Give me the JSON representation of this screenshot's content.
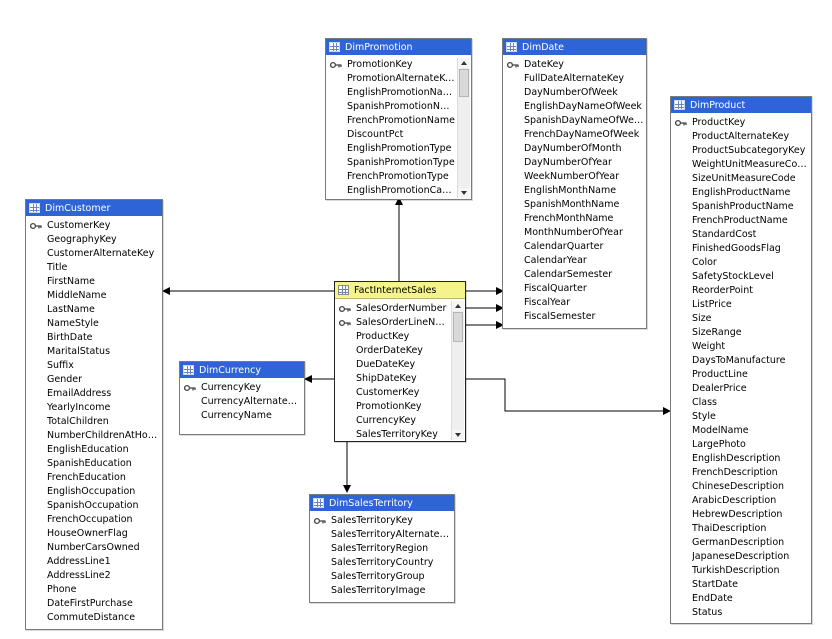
{
  "tables": {
    "promotion": {
      "title": "DimPromotion",
      "columns": [
        {
          "name": "PromotionKey",
          "key": true
        },
        {
          "name": "PromotionAlternateKey"
        },
        {
          "name": "EnglishPromotionName"
        },
        {
          "name": "SpanishPromotionName"
        },
        {
          "name": "FrenchPromotionName"
        },
        {
          "name": "DiscountPct"
        },
        {
          "name": "EnglishPromotionType"
        },
        {
          "name": "SpanishPromotionType"
        },
        {
          "name": "FrenchPromotionType"
        },
        {
          "name": "EnglishPromotionCate…"
        }
      ]
    },
    "date": {
      "title": "DimDate",
      "columns": [
        {
          "name": "DateKey",
          "key": true
        },
        {
          "name": "FullDateAlternateKey"
        },
        {
          "name": "DayNumberOfWeek"
        },
        {
          "name": "EnglishDayNameOfWeek"
        },
        {
          "name": "SpanishDayNameOfWeek"
        },
        {
          "name": "FrenchDayNameOfWeek"
        },
        {
          "name": "DayNumberOfMonth"
        },
        {
          "name": "DayNumberOfYear"
        },
        {
          "name": "WeekNumberOfYear"
        },
        {
          "name": "EnglishMonthName"
        },
        {
          "name": "SpanishMonthName"
        },
        {
          "name": "FrenchMonthName"
        },
        {
          "name": "MonthNumberOfYear"
        },
        {
          "name": "CalendarQuarter"
        },
        {
          "name": "CalendarYear"
        },
        {
          "name": "CalendarSemester"
        },
        {
          "name": "FiscalQuarter"
        },
        {
          "name": "FiscalYear"
        },
        {
          "name": "FiscalSemester"
        }
      ]
    },
    "product": {
      "title": "DimProduct",
      "columns": [
        {
          "name": "ProductKey",
          "key": true
        },
        {
          "name": "ProductAlternateKey"
        },
        {
          "name": "ProductSubcategoryKey"
        },
        {
          "name": "WeightUnitMeasureCode"
        },
        {
          "name": "SizeUnitMeasureCode"
        },
        {
          "name": "EnglishProductName"
        },
        {
          "name": "SpanishProductName"
        },
        {
          "name": "FrenchProductName"
        },
        {
          "name": "StandardCost"
        },
        {
          "name": "FinishedGoodsFlag"
        },
        {
          "name": "Color"
        },
        {
          "name": "SafetyStockLevel"
        },
        {
          "name": "ReorderPoint"
        },
        {
          "name": "ListPrice"
        },
        {
          "name": "Size"
        },
        {
          "name": "SizeRange"
        },
        {
          "name": "Weight"
        },
        {
          "name": "DaysToManufacture"
        },
        {
          "name": "ProductLine"
        },
        {
          "name": "DealerPrice"
        },
        {
          "name": "Class"
        },
        {
          "name": "Style"
        },
        {
          "name": "ModelName"
        },
        {
          "name": "LargePhoto"
        },
        {
          "name": "EnglishDescription"
        },
        {
          "name": "FrenchDescription"
        },
        {
          "name": "ChineseDescription"
        },
        {
          "name": "ArabicDescription"
        },
        {
          "name": "HebrewDescription"
        },
        {
          "name": "ThaiDescription"
        },
        {
          "name": "GermanDescription"
        },
        {
          "name": "JapaneseDescription"
        },
        {
          "name": "TurkishDescription"
        },
        {
          "name": "StartDate"
        },
        {
          "name": "EndDate"
        },
        {
          "name": "Status"
        }
      ]
    },
    "customer": {
      "title": "DimCustomer",
      "columns": [
        {
          "name": "CustomerKey",
          "key": true
        },
        {
          "name": "GeographyKey"
        },
        {
          "name": "CustomerAlternateKey"
        },
        {
          "name": "Title"
        },
        {
          "name": "FirstName"
        },
        {
          "name": "MiddleName"
        },
        {
          "name": "LastName"
        },
        {
          "name": "NameStyle"
        },
        {
          "name": "BirthDate"
        },
        {
          "name": "MaritalStatus"
        },
        {
          "name": "Suffix"
        },
        {
          "name": "Gender"
        },
        {
          "name": "EmailAddress"
        },
        {
          "name": "YearlyIncome"
        },
        {
          "name": "TotalChildren"
        },
        {
          "name": "NumberChildrenAtHome"
        },
        {
          "name": "EnglishEducation"
        },
        {
          "name": "SpanishEducation"
        },
        {
          "name": "FrenchEducation"
        },
        {
          "name": "EnglishOccupation"
        },
        {
          "name": "SpanishOccupation"
        },
        {
          "name": "FrenchOccupation"
        },
        {
          "name": "HouseOwnerFlag"
        },
        {
          "name": "NumberCarsOwned"
        },
        {
          "name": "AddressLine1"
        },
        {
          "name": "AddressLine2"
        },
        {
          "name": "Phone"
        },
        {
          "name": "DateFirstPurchase"
        },
        {
          "name": "CommuteDistance"
        }
      ]
    },
    "fact": {
      "title": "FactInternetSales",
      "columns": [
        {
          "name": "SalesOrderNumber",
          "key": true
        },
        {
          "name": "SalesOrderLineNu…",
          "key": true
        },
        {
          "name": "ProductKey"
        },
        {
          "name": "OrderDateKey"
        },
        {
          "name": "DueDateKey"
        },
        {
          "name": "ShipDateKey"
        },
        {
          "name": "CustomerKey"
        },
        {
          "name": "PromotionKey"
        },
        {
          "name": "CurrencyKey"
        },
        {
          "name": "SalesTerritoryKey"
        }
      ]
    },
    "currency": {
      "title": "DimCurrency",
      "columns": [
        {
          "name": "CurrencyKey",
          "key": true
        },
        {
          "name": "CurrencyAlternateKey"
        },
        {
          "name": "CurrencyName"
        }
      ]
    },
    "territory": {
      "title": "DimSalesTerritory",
      "columns": [
        {
          "name": "SalesTerritoryKey",
          "key": true
        },
        {
          "name": "SalesTerritoryAlternateKey"
        },
        {
          "name": "SalesTerritoryRegion"
        },
        {
          "name": "SalesTerritoryCountry"
        },
        {
          "name": "SalesTerritoryGroup"
        },
        {
          "name": "SalesTerritoryImage"
        }
      ]
    }
  },
  "colors": {
    "header_blue": "#2f64d6",
    "fact_header_yellow": "#f4f38c",
    "connector": "#000000"
  }
}
